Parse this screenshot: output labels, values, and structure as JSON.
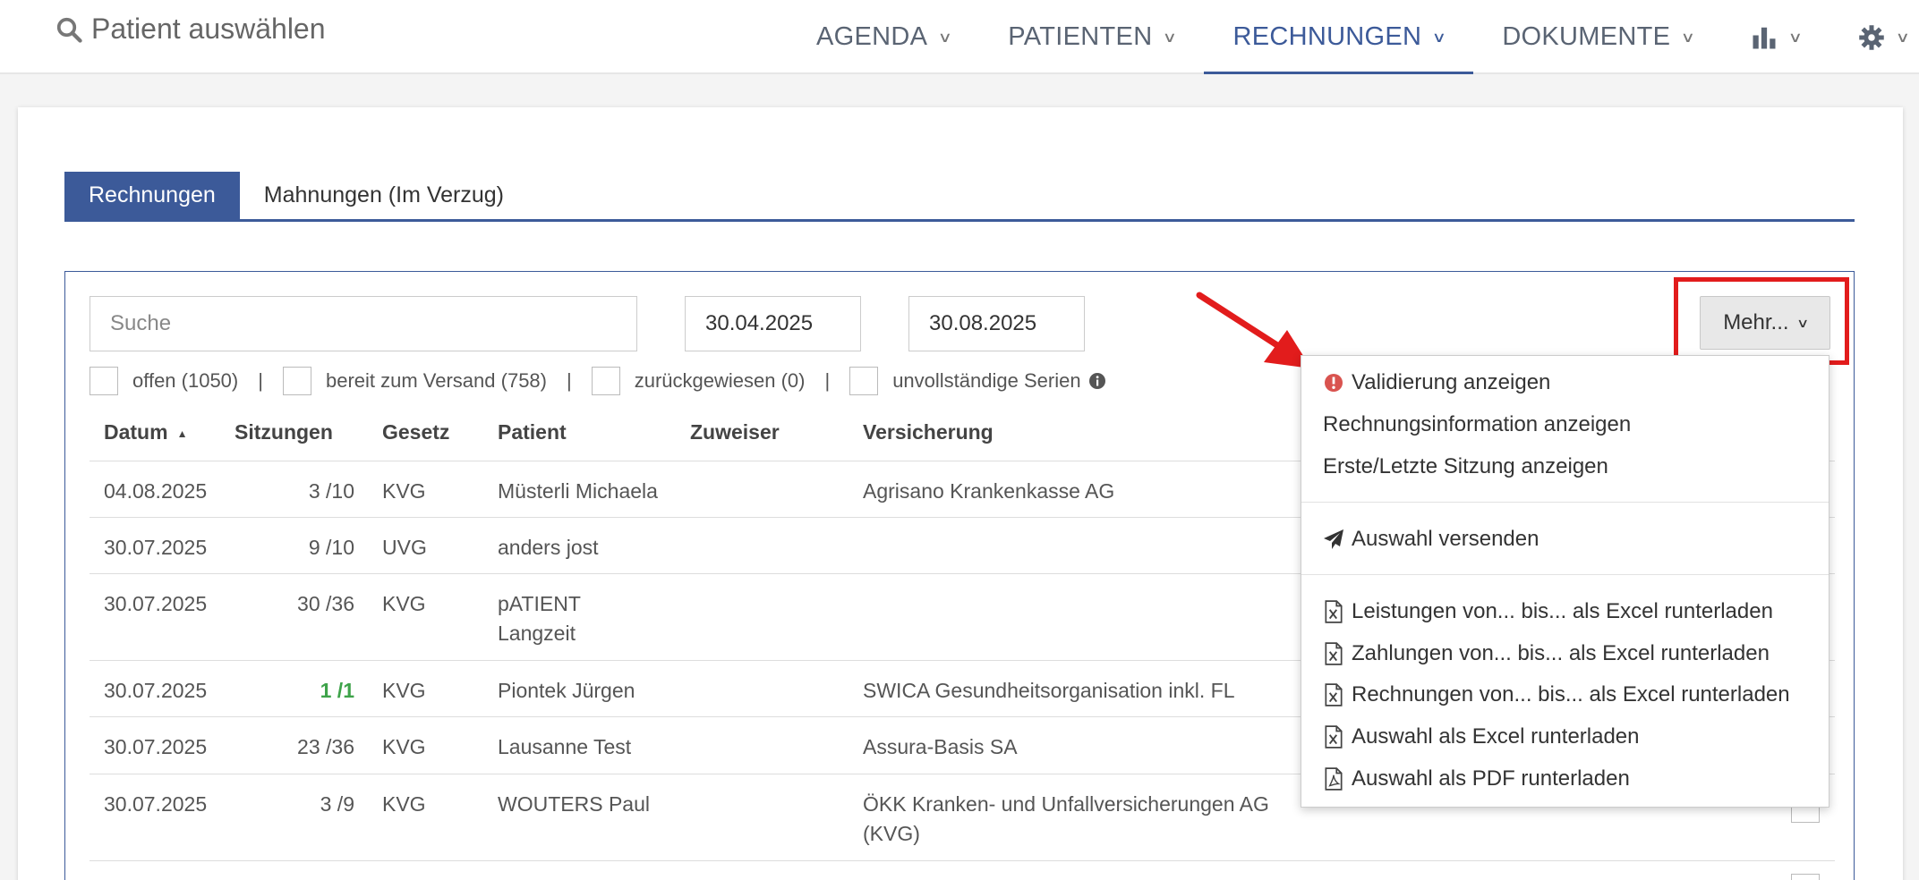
{
  "header": {
    "patient_search": "Patient auswählen",
    "nav": [
      {
        "label": "AGENDA"
      },
      {
        "label": "PATIENTEN"
      },
      {
        "label": "RECHNUNGEN"
      },
      {
        "label": "DOKUMENTE"
      }
    ]
  },
  "tabs": [
    {
      "label": "Rechnungen"
    },
    {
      "label": "Mahnungen (Im Verzug)"
    }
  ],
  "search": {
    "placeholder": "Suche"
  },
  "dates": {
    "from": "30.04.2025",
    "to": "30.08.2025"
  },
  "filters": [
    {
      "label": "offen (1050)"
    },
    {
      "label": "bereit zum Versand (758)"
    },
    {
      "label": "zurückgewiesen (0)"
    },
    {
      "label": "unvollständige Serien"
    }
  ],
  "separator": "|",
  "mehr_button": "Mehr...",
  "table": {
    "headers": [
      "Datum",
      "Sitzungen",
      "Gesetz",
      "Patient",
      "Zuweiser",
      "Versicherung"
    ],
    "rows": [
      {
        "datum": "04.08.2025",
        "sitzungen": "3 /10",
        "gesetz": "KVG",
        "patient": "Müsterli Michaela",
        "patient2": "",
        "zuweiser": "",
        "versicherung": "Agrisano Krankenkasse AG",
        "versicherung2": ""
      },
      {
        "datum": "30.07.2025",
        "sitzungen": "9 /10",
        "gesetz": "UVG",
        "patient": "anders jost",
        "patient2": "",
        "zuweiser": "",
        "versicherung": "",
        "versicherung2": ""
      },
      {
        "datum": "30.07.2025",
        "sitzungen": "30 /36",
        "gesetz": "KVG",
        "patient": "pATIENT",
        "patient2": "Langzeit",
        "zuweiser": "",
        "versicherung": "",
        "versicherung2": ""
      },
      {
        "datum": "30.07.2025",
        "sitzungen": "1 /1",
        "gesetz": "KVG",
        "patient": "Piontek Jürgen",
        "patient2": "",
        "zuweiser": "",
        "versicherung": "SWICA Gesundheitsorganisation inkl. FL",
        "versicherung2": ""
      },
      {
        "datum": "30.07.2025",
        "sitzungen": "23 /36",
        "gesetz": "KVG",
        "patient": "Lausanne Test",
        "patient2": "",
        "zuweiser": "",
        "versicherung": "Assura-Basis SA",
        "versicherung2": ""
      },
      {
        "datum": "30.07.2025",
        "sitzungen": "3 /9",
        "gesetz": "KVG",
        "patient": "WOUTERS Paul",
        "patient2": "",
        "zuweiser": "",
        "versicherung": "ÖKK Kranken- und Unfallversicherungen AG",
        "versicherung2": "(KVG)"
      }
    ]
  },
  "menu": {
    "items": [
      {
        "label": "Validierung anzeigen",
        "icon": "exclamation-circle-icon"
      },
      {
        "label": "Rechnungsinformation anzeigen"
      },
      {
        "label": "Erste/Letzte Sitzung anzeigen"
      },
      {
        "label": "Auswahl versenden",
        "icon": "paper-plane-icon"
      },
      {
        "label": "Leistungen von... bis... als Excel runterladen",
        "icon": "excel-file-icon"
      },
      {
        "label": "Zahlungen von... bis... als Excel runterladen",
        "icon": "excel-file-icon"
      },
      {
        "label": "Rechnungen von... bis... als Excel runterladen",
        "icon": "excel-file-icon"
      },
      {
        "label": "Auswahl als Excel runterladen",
        "icon": "excel-file-icon"
      },
      {
        "label": "Auswahl als PDF runterladen",
        "icon": "pdf-file-icon"
      }
    ]
  },
  "colors": {
    "primary": "#3c5a99",
    "highlight_red": "#e21c1c",
    "success_green": "#3ea34a"
  }
}
